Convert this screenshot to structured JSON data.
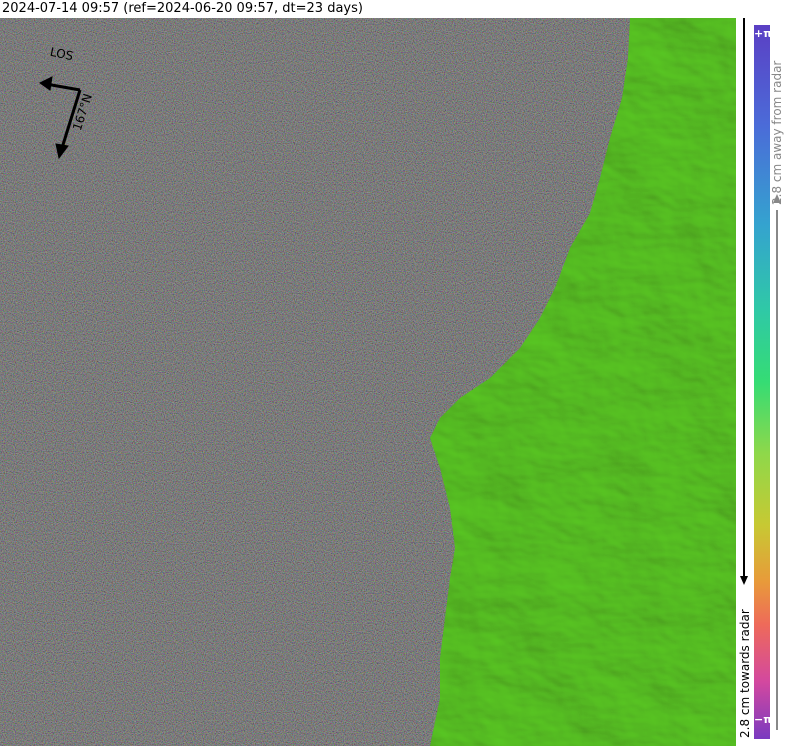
{
  "title": "2024-07-14 09:57 (ref=2024-06-20 09:57, dt=23 days)",
  "compass": {
    "los_label": "LOS",
    "heading_label": "167°N"
  },
  "colorbar": {
    "top_label": "+π",
    "bottom_label": "−π",
    "away_label": "2.8 cm away from radar",
    "towards_label": "2.8 cm towards radar",
    "colors": [
      "#5b3fc4",
      "#34a3cf",
      "#35dc74",
      "#c7c933",
      "#ee6a5a",
      "#7a3ac0"
    ]
  },
  "map": {
    "coherent_color": "#7ddc3c",
    "noise_colors": [
      "#d24fa0",
      "#3fb7c7",
      "#6ed27a",
      "#c9b24a",
      "#7a6fd0",
      "#e07a6a",
      "#8a8a8a",
      "#4a4a4a"
    ]
  }
}
